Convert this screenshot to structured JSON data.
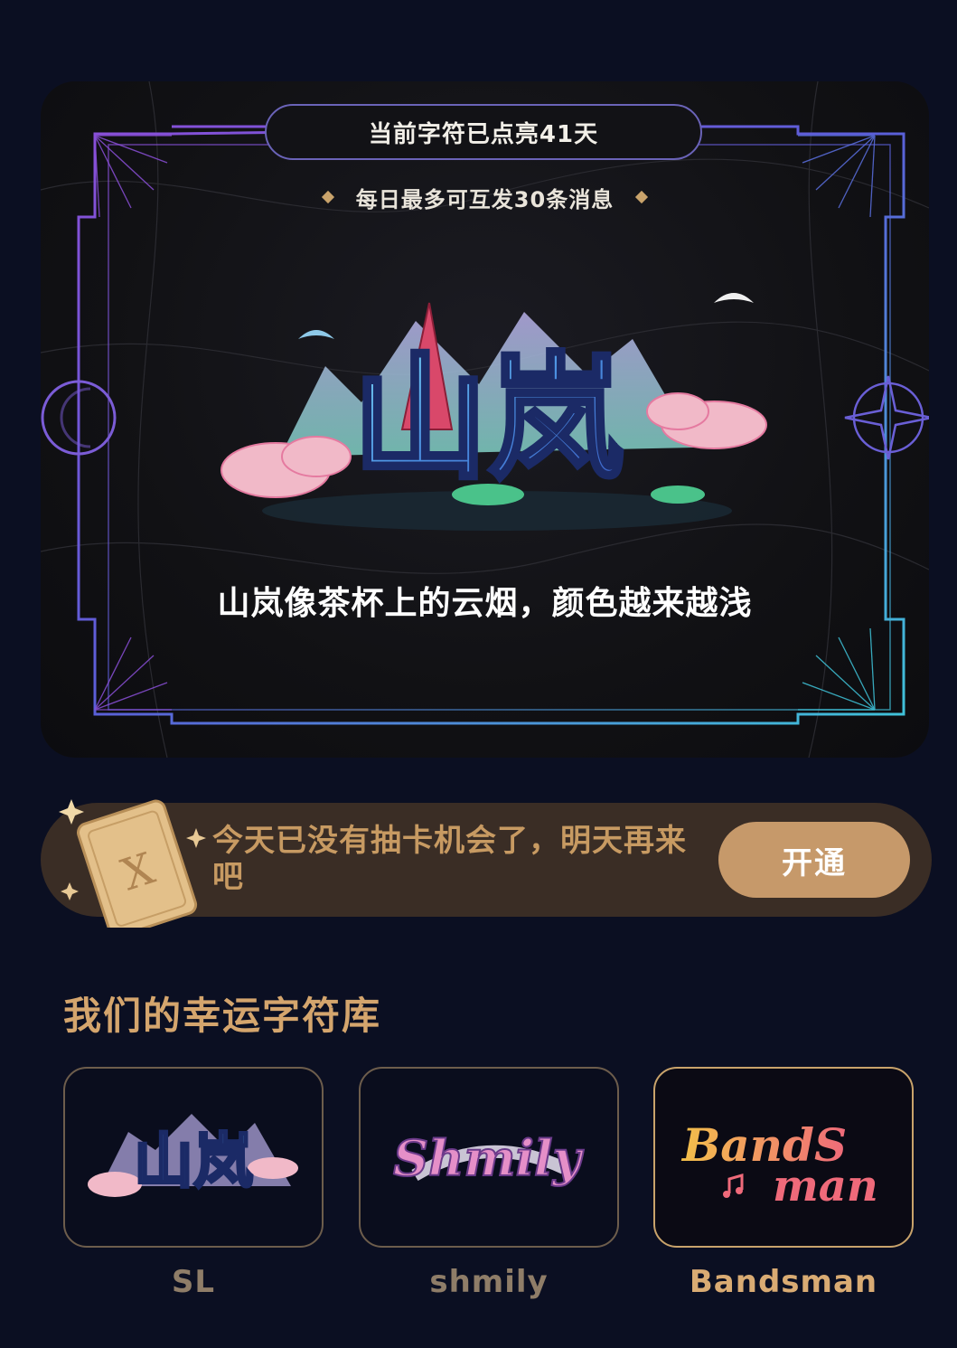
{
  "lit_card": {
    "streak_text": "当前字符已点亮41天",
    "limit_text": "每日最多可互发30条消息",
    "character_art_label": "山岚",
    "caption": "山岚像茶杯上的云烟，颜色越来越浅"
  },
  "draw": {
    "message": "今天已没有抽卡机会了，明天再来吧",
    "button_label": "开通"
  },
  "library": {
    "title": "我们的幸运字符库",
    "items": [
      {
        "art_text": "山岚",
        "label": "SL"
      },
      {
        "art_text": "Shmily",
        "label": "shmily"
      },
      {
        "art_text_1": "BandS",
        "art_text_2": "man",
        "label": "Bandsman",
        "selected": true
      }
    ]
  },
  "colors": {
    "background": "#0b0f22",
    "accent_gold": "#c6996a",
    "frame_purple": "#7b5cd6",
    "frame_cyan": "#3fc3d9"
  }
}
